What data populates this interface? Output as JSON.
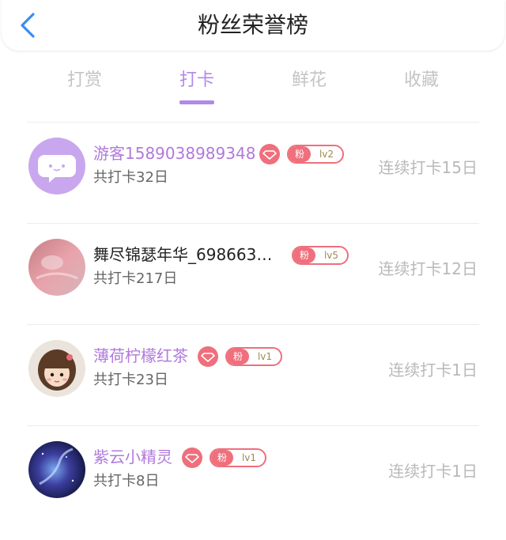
{
  "header": {
    "title": "粉丝荣誉榜",
    "back_icon": "chevron-left-icon",
    "accent": "#3b8bf5"
  },
  "tabs": [
    {
      "label": "打赏",
      "active": false
    },
    {
      "label": "打卡",
      "active": true
    },
    {
      "label": "鲜花",
      "active": false
    },
    {
      "label": "收藏",
      "active": false
    }
  ],
  "colors": {
    "tab_active": "#b18ae8",
    "username": "#b179dd",
    "badge": "#ef6f7c",
    "streak": "#b9b9b9"
  },
  "fans": [
    {
      "name": "游客1589038989348",
      "total": "共打卡32日",
      "badge_fan": "粉",
      "badge_level": "lv2",
      "streak": "连续打卡15日",
      "has_diamond": true,
      "avatar": "chat-bubble-avatar"
    },
    {
      "name": "舞尽锦瑟年华_698663…",
      "total": "共打卡217日",
      "badge_fan": "粉",
      "badge_level": "lv5",
      "streak": "连续打卡12日",
      "has_diamond": false,
      "avatar": "pink-photo-avatar"
    },
    {
      "name": "薄荷柠檬红茶",
      "total": "共打卡23日",
      "badge_fan": "粉",
      "badge_level": "lv1",
      "streak": "连续打卡1日",
      "has_diamond": true,
      "avatar": "cartoon-girl-avatar"
    },
    {
      "name": "紫云小精灵",
      "total": "共打卡8日",
      "badge_fan": "粉",
      "badge_level": "lv1",
      "streak": "连续打卡1日",
      "has_diamond": true,
      "avatar": "galaxy-avatar"
    }
  ]
}
